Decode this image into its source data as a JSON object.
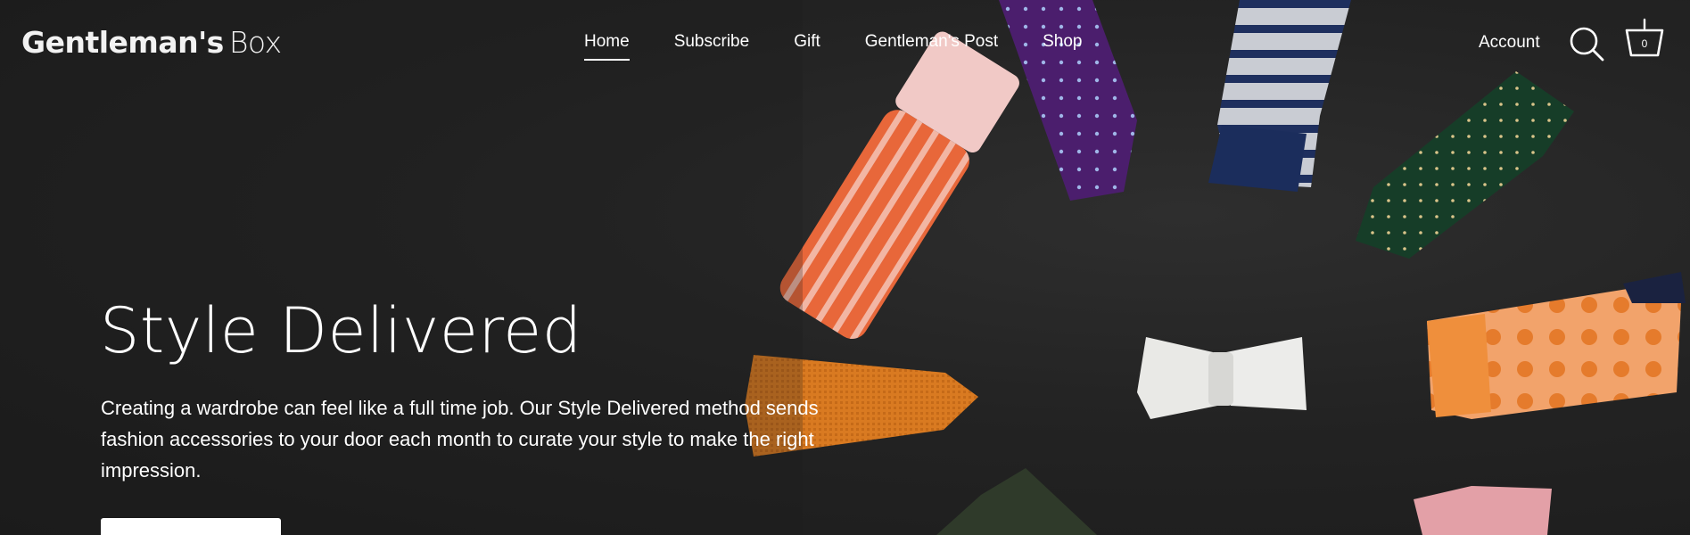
{
  "brand": {
    "name_part1": "Gentleman's",
    "name_part2": "Box"
  },
  "nav": {
    "items": [
      {
        "label": "Home",
        "active": true
      },
      {
        "label": "Subscribe",
        "active": false
      },
      {
        "label": "Gift",
        "active": false
      },
      {
        "label": "Gentleman's Post",
        "active": false
      },
      {
        "label": "Shop",
        "active": false
      }
    ]
  },
  "header": {
    "account_label": "Account",
    "search_icon": "search-icon",
    "cart_icon": "basket-icon",
    "cart_count": "0"
  },
  "hero": {
    "title": "Style Delivered",
    "description": "Creating a wardrobe can feel like a full time job. Our Style Delivered method sends fashion accessories to your door each month to curate your style to make the right impression.",
    "cta_label": ""
  },
  "colors": {
    "background": "#222222",
    "text": "#ffffff",
    "button": "#ffffff"
  }
}
